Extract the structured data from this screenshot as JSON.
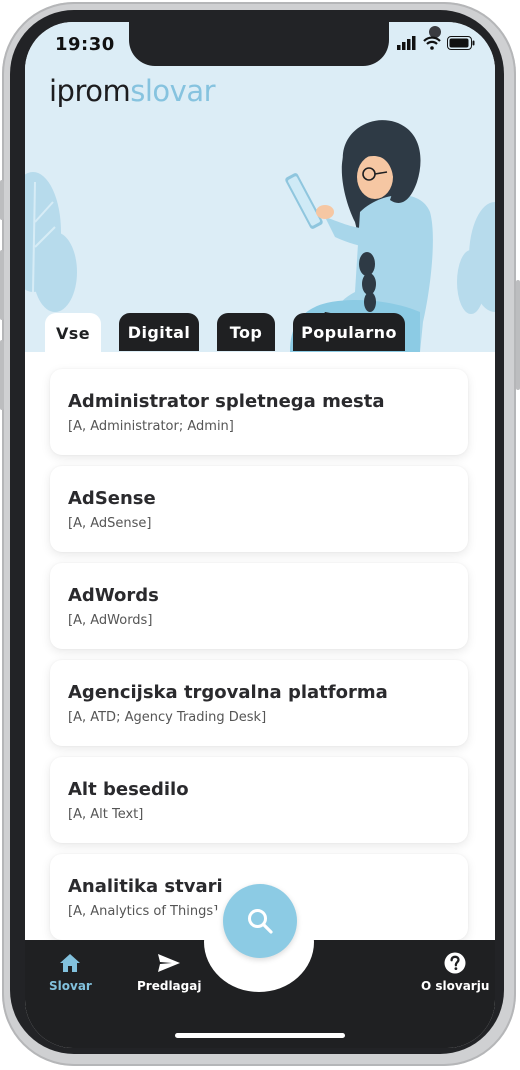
{
  "status_bar": {
    "time": "19:30"
  },
  "brand": {
    "part1": "iprom",
    "part2": "slovar"
  },
  "tabs": [
    {
      "label": "Vse",
      "active": true
    },
    {
      "label": "Digital",
      "active": false
    },
    {
      "label": "Top",
      "active": false
    },
    {
      "label": "Popularno",
      "active": false
    }
  ],
  "terms": [
    {
      "title": "Administrator spletnega mesta",
      "sub": "[A, Administrator; Admin]"
    },
    {
      "title": "AdSense",
      "sub": "[A, AdSense]"
    },
    {
      "title": "AdWords",
      "sub": "[A, AdWords]"
    },
    {
      "title": "Agencijska trgovalna platforma",
      "sub": "[A, ATD; Agency Trading Desk]"
    },
    {
      "title": "Alt besedilo",
      "sub": "[A, Alt Text]"
    },
    {
      "title": "Analitika stvari",
      "sub": "[A, Analytics of Things]"
    }
  ],
  "bottom_nav": {
    "slovar": "Slovar",
    "predlagaj": "Predlagaj",
    "o_slovarju": "O slovarju"
  },
  "colors": {
    "accent": "#86c3df",
    "hero_bg": "#dcedf6",
    "dark": "#1f2022"
  },
  "icons": [
    "home-icon",
    "send-icon",
    "help-icon",
    "search-icon",
    "signal-icon",
    "wifi-icon",
    "battery-icon"
  ]
}
